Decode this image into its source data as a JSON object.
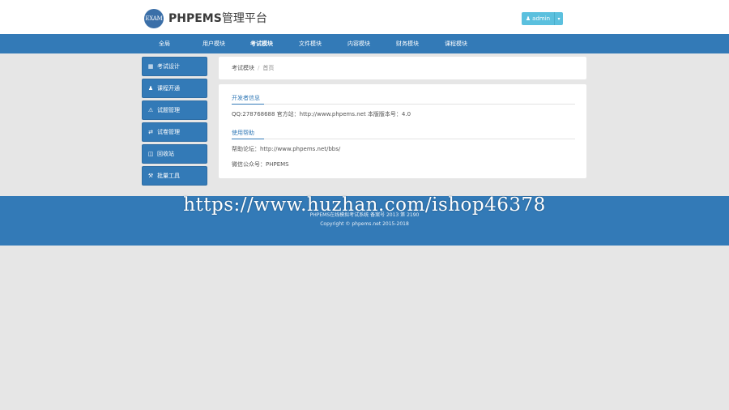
{
  "header": {
    "logo_badge": "EXAM",
    "title_en": "PHPEMS",
    "title_zh": "管理平台",
    "user_button": {
      "label": "admin",
      "icon": "user-icon",
      "caret": "▾"
    }
  },
  "nav": {
    "items": [
      {
        "label": "全局"
      },
      {
        "label": "用户模块"
      },
      {
        "label": "考试模块"
      },
      {
        "label": "文件模块"
      },
      {
        "label": "内容模块"
      },
      {
        "label": "财务模块"
      },
      {
        "label": "课程模块"
      }
    ]
  },
  "sidebar": {
    "items": [
      {
        "icon": "grid-icon",
        "glyph": "▦",
        "label": "考试设计"
      },
      {
        "icon": "user-icon",
        "glyph": "👤",
        "label": "课程开通"
      },
      {
        "icon": "warning-icon",
        "glyph": "⚠",
        "label": "试题管理"
      },
      {
        "icon": "share-icon",
        "glyph": "⇄",
        "label": "试卷管理"
      },
      {
        "icon": "trash-icon",
        "glyph": "🗑",
        "label": "回收站"
      },
      {
        "icon": "wrench-icon",
        "glyph": "🔧",
        "label": "批量工具"
      }
    ]
  },
  "breadcrumb": {
    "module": "考试模块",
    "separator": "/",
    "current": "首页"
  },
  "content": {
    "developer_title": "开发者信息",
    "developer_info": "QQ:278768688 官方站：http://www.phpems.net 本版版本号：4.0",
    "help_title": "使用帮助",
    "forum": "帮助论坛：http://www.phpems.net/bbs/",
    "wechat": "微信公众号：PHPEMS"
  },
  "footer": {
    "line1": "PHPEMS在线模拟考试系统 备案号 2013 第 2190",
    "line2": "Copyright © phpems.net 2015-2018"
  },
  "watermark": "https://www.huzhan.com/ishop46378",
  "colors": {
    "primary": "#337ab7",
    "info_button": "#5bc0de",
    "background": "#e6e6e6"
  }
}
